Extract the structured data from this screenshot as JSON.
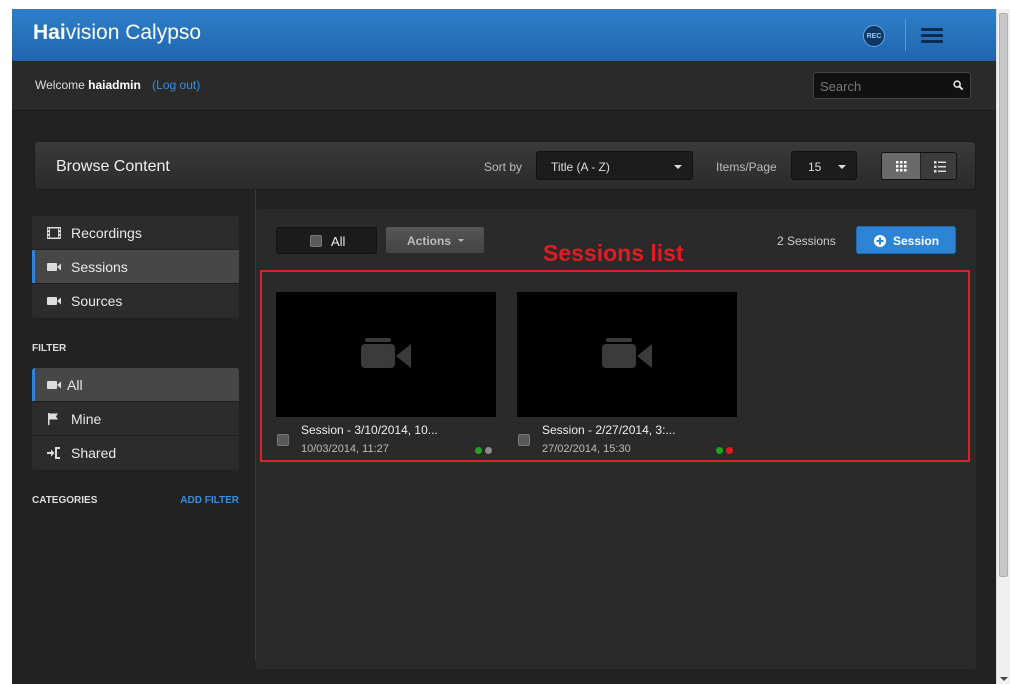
{
  "app": {
    "brand_bold": "Hai",
    "brand_rest": "vision Calypso",
    "rec_label": "REC",
    "accent_color": "#1f6fc0"
  },
  "subbar": {
    "welcome_prefix": "Welcome",
    "username": "haiadmin",
    "logout_label": "(Log out)",
    "search_placeholder": "Search"
  },
  "browse": {
    "title": "Browse Content",
    "sort_label": "Sort by",
    "sort_value": "Title (A - Z)",
    "items_label": "Items/Page",
    "items_value": "15",
    "view_mode": "grid"
  },
  "sidebar": {
    "nav": [
      {
        "label": "Recordings",
        "icon": "film-icon",
        "active": false
      },
      {
        "label": "Sessions",
        "icon": "video-camera-icon",
        "active": true
      },
      {
        "label": "Sources",
        "icon": "video-camera-icon",
        "active": false
      }
    ],
    "filter_heading": "FILTER",
    "filters": [
      {
        "label": "All",
        "icon": "video-camera-icon",
        "active": true
      },
      {
        "label": "Mine",
        "icon": "flag-icon",
        "active": false
      },
      {
        "label": "Shared",
        "icon": "share-icon",
        "active": false
      }
    ],
    "categories_heading": "CATEGORIES",
    "add_filter_label": "ADD FILTER"
  },
  "content": {
    "select_all_label": "All",
    "actions_label": "Actions",
    "sessions_count": "2 Sessions",
    "add_session_label": "Session",
    "annotation_label": "Sessions list",
    "sessions": [
      {
        "title": "Session - 3/10/2014, 10...",
        "date": "10/03/2014, 11:27",
        "status": [
          "#1fa51f",
          "#8a8a8a"
        ]
      },
      {
        "title": "Session - 2/27/2014, 3:...",
        "date": "27/02/2014, 15:30",
        "status": [
          "#1fa51f",
          "#e01b1b"
        ]
      }
    ]
  }
}
